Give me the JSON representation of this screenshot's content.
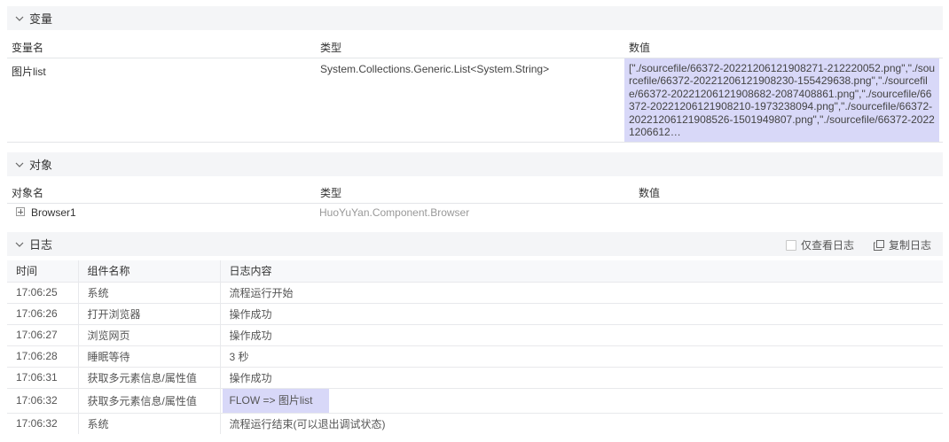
{
  "variables": {
    "section_title": "变量",
    "columns": [
      "变量名",
      "类型",
      "数值"
    ],
    "rows": [
      {
        "name": "图片list",
        "type": "System.Collections.Generic.List<System.String>",
        "value": "[\"./sourcefile/66372-20221206121908271-212220052.png\",\"./sourcefile/66372-20221206121908230-155429638.png\",\"./sourcefile/66372-20221206121908682-2087408861.png\",\"./sourcefile/66372-20221206121908210-1973238094.png\",\"./sourcefile/66372-20221206121908526-1501949807.png\",\"./sourcefile/66372-20221206612…"
      }
    ]
  },
  "objects": {
    "section_title": "对象",
    "columns": [
      "对象名",
      "类型",
      "数值"
    ],
    "rows": [
      {
        "name": "Browser1",
        "type": "HuoYuYan.Component.Browser",
        "value": ""
      }
    ]
  },
  "log": {
    "section_title": "日志",
    "only_log_label": "仅查看日志",
    "only_log_checked": false,
    "copy_label": "复制日志",
    "columns": [
      "时间",
      "组件名称",
      "日志内容"
    ],
    "rows": [
      {
        "time": "17:06:25",
        "component": "系统",
        "content": "流程运行开始"
      },
      {
        "time": "17:06:26",
        "component": "打开浏览器",
        "content": "操作成功"
      },
      {
        "time": "17:06:27",
        "component": "浏览网页",
        "content": "操作成功"
      },
      {
        "time": "17:06:28",
        "component": "睡眠等待",
        "content": "3 秒"
      },
      {
        "time": "17:06:31",
        "component": "获取多元素信息/属性值",
        "content": "操作成功"
      },
      {
        "time": "17:06:32",
        "component": "获取多元素信息/属性值",
        "content": "FLOW => 图片list"
      },
      {
        "time": "17:06:32",
        "component": "系统",
        "content": "流程运行结束(可以退出调试状态)"
      }
    ]
  },
  "colors": {
    "highlight": "#d8d8f8",
    "header_bg": "#f4f5f7"
  },
  "icons": {
    "collapse": "chevron-down-icon",
    "expand": "plus-square-icon",
    "copy": "copy-icon"
  }
}
